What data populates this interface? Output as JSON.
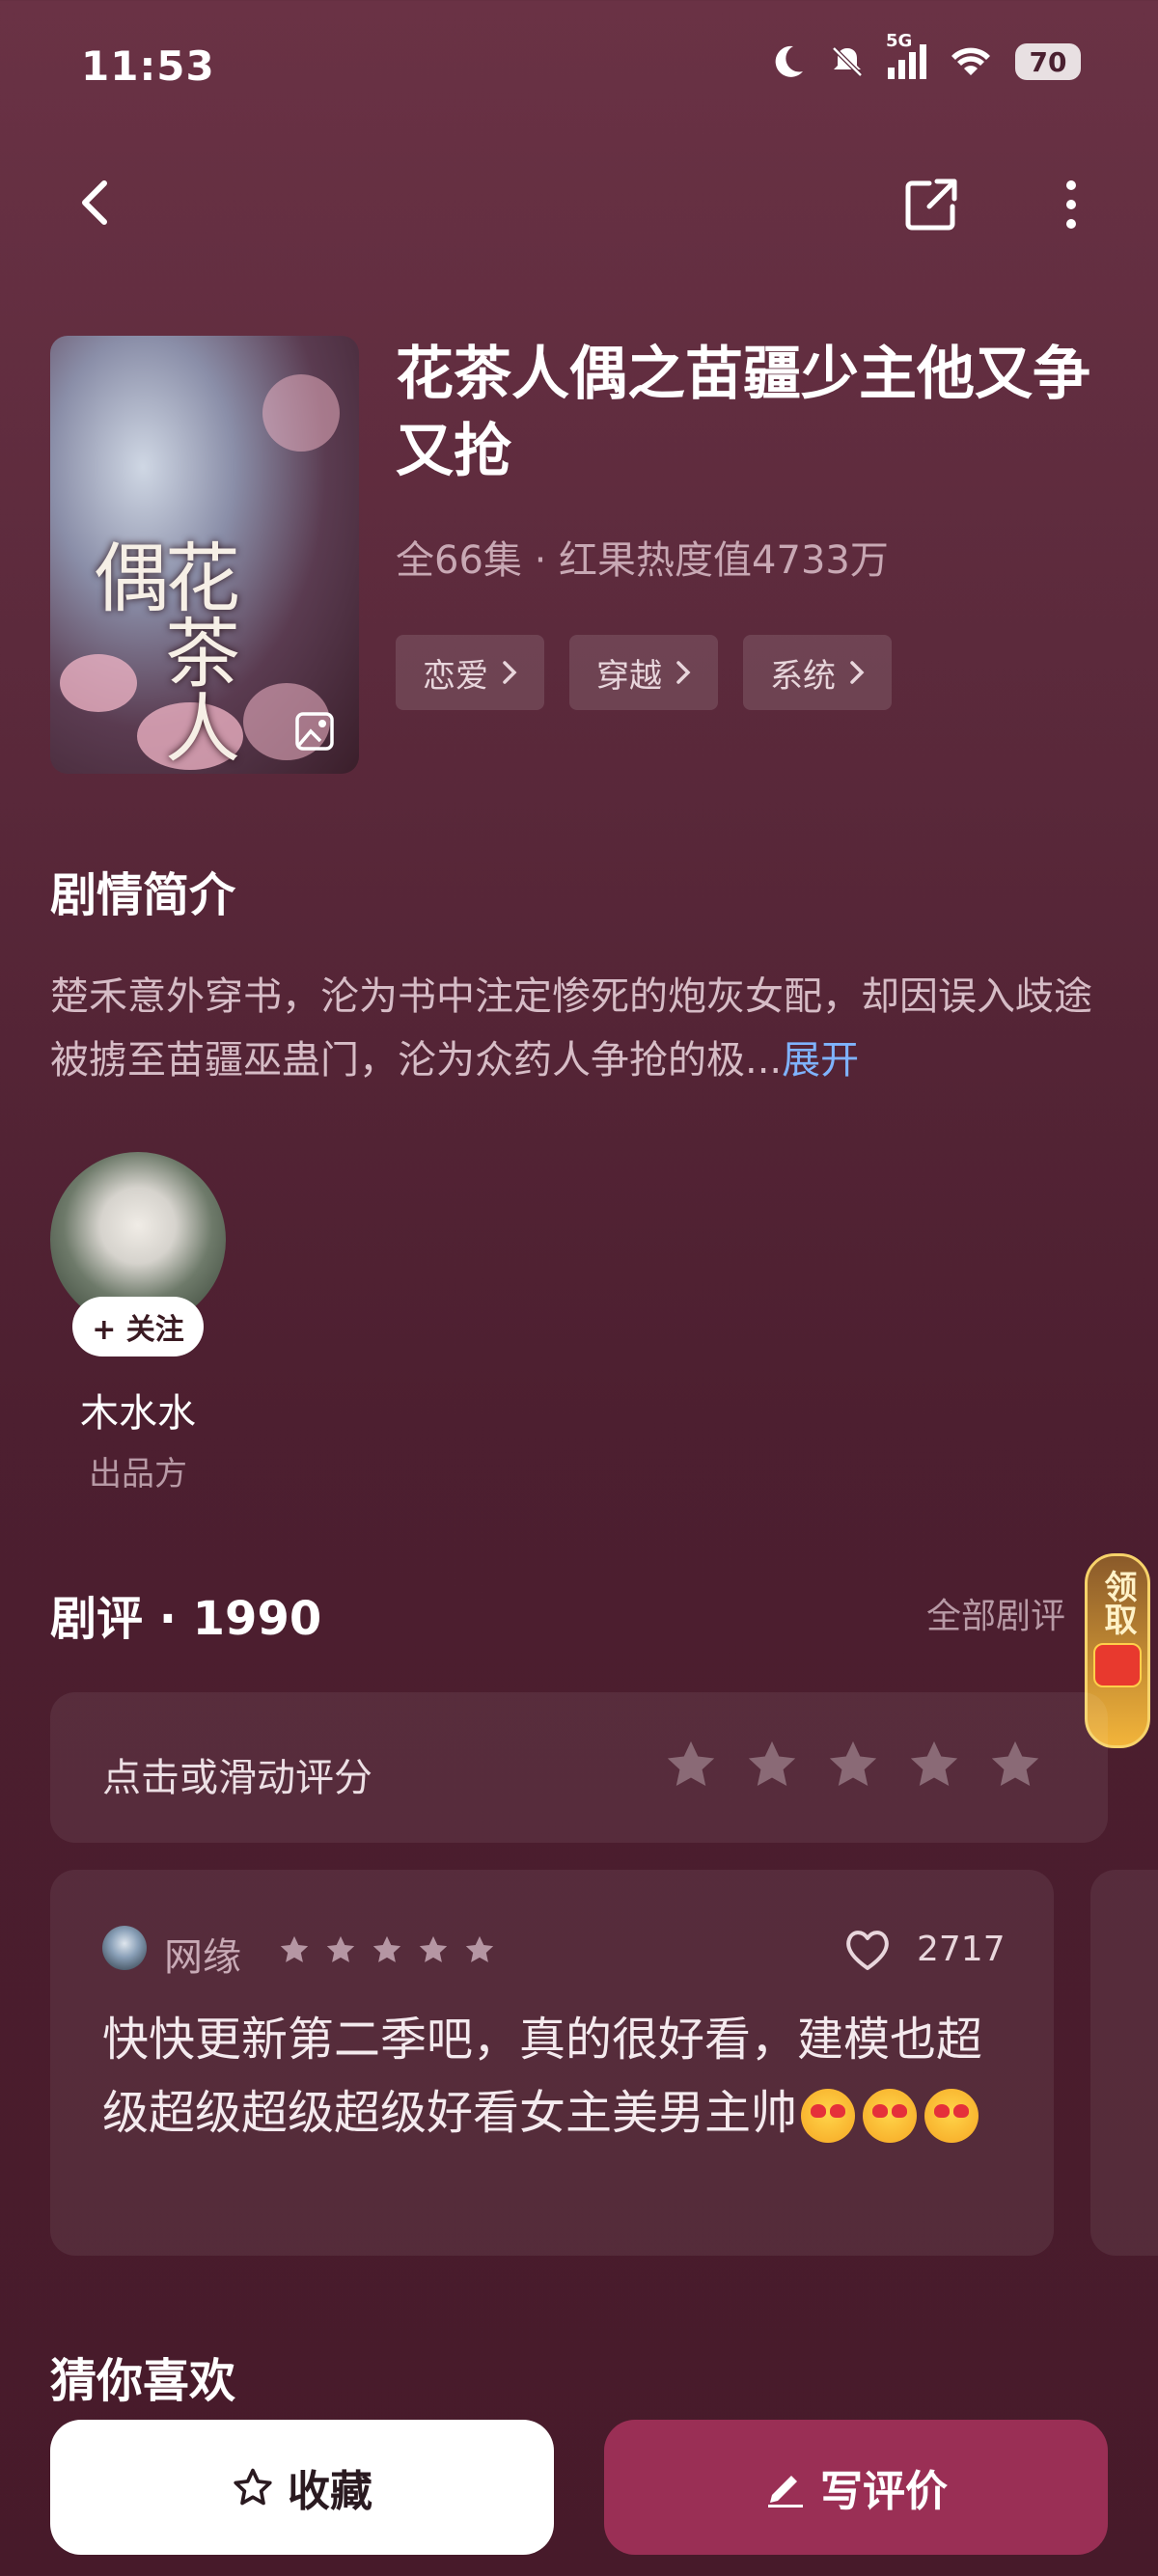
{
  "status_bar": {
    "time": "11:53",
    "network": "5G",
    "battery": "70"
  },
  "drama": {
    "title": "花茶人偶之苗疆少主他又争又抢",
    "meta": "全66集 · 红果热度值4733万",
    "poster_text": "花茶人偶",
    "tags": [
      "恋爱",
      "穿越",
      "系统"
    ]
  },
  "synopsis": {
    "title": "剧情简介",
    "text": "楚禾意外穿书，沦为书中注定惨死的炮灰女配，却因误入歧途被掳至苗疆巫蛊门，沦为众药人争抢的极...",
    "expand": "展开"
  },
  "producer": {
    "follow": "+ 关注",
    "name": "木水水",
    "role": "出品方"
  },
  "reviews": {
    "title": "剧评 · 1990",
    "view_all": "全部剧评",
    "reward": "领取",
    "rating_prompt": "点击或滑动评分",
    "items": [
      {
        "user": "网缘",
        "stars": 5,
        "likes": "2717",
        "text": "快快更新第二季吧，真的很好看，建模也超级超级超级超级好看女主美男主帅"
      }
    ]
  },
  "recommend": {
    "title": "猜你喜欢"
  },
  "actions": {
    "collect": "收藏",
    "review": "写评价"
  },
  "colors": {
    "accent": "#9a2f55",
    "link": "#7fb3ff",
    "background": "#5c2a3c"
  }
}
